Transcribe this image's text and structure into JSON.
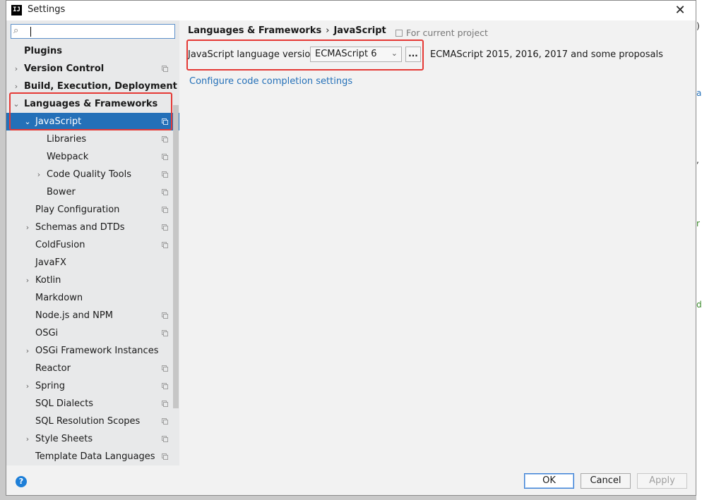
{
  "window": {
    "title": "Settings",
    "app_icon_text": "IJ"
  },
  "search": {
    "placeholder": "",
    "value": ""
  },
  "sidebar": {
    "items": [
      {
        "label": "Plugins",
        "bold": true,
        "arrow": "",
        "copy": false
      },
      {
        "label": "Version Control",
        "bold": true,
        "arrow": "right",
        "copy": true
      },
      {
        "label": "Build, Execution, Deployment",
        "bold": true,
        "arrow": "right",
        "copy": false
      },
      {
        "label": "Languages & Frameworks",
        "bold": true,
        "arrow": "down",
        "copy": false
      },
      {
        "label": "JavaScript",
        "bold": false,
        "arrow": "down",
        "copy": true,
        "selected": true
      },
      {
        "label": "Libraries",
        "bold": false,
        "arrow": "",
        "copy": true
      },
      {
        "label": "Webpack",
        "bold": false,
        "arrow": "",
        "copy": true
      },
      {
        "label": "Code Quality Tools",
        "bold": false,
        "arrow": "right",
        "copy": true
      },
      {
        "label": "Bower",
        "bold": false,
        "arrow": "",
        "copy": true
      },
      {
        "label": "Play Configuration",
        "bold": false,
        "arrow": "",
        "copy": true
      },
      {
        "label": "Schemas and DTDs",
        "bold": false,
        "arrow": "right",
        "copy": true
      },
      {
        "label": "ColdFusion",
        "bold": false,
        "arrow": "",
        "copy": true
      },
      {
        "label": "JavaFX",
        "bold": false,
        "arrow": "",
        "copy": false
      },
      {
        "label": "Kotlin",
        "bold": false,
        "arrow": "right",
        "copy": false
      },
      {
        "label": "Markdown",
        "bold": false,
        "arrow": "",
        "copy": false
      },
      {
        "label": "Node.js and NPM",
        "bold": false,
        "arrow": "",
        "copy": true
      },
      {
        "label": "OSGi",
        "bold": false,
        "arrow": "",
        "copy": true
      },
      {
        "label": "OSGi Framework Instances",
        "bold": false,
        "arrow": "right",
        "copy": false
      },
      {
        "label": "Reactor",
        "bold": false,
        "arrow": "",
        "copy": true
      },
      {
        "label": "Spring",
        "bold": false,
        "arrow": "right",
        "copy": true
      },
      {
        "label": "SQL Dialects",
        "bold": false,
        "arrow": "",
        "copy": true
      },
      {
        "label": "SQL Resolution Scopes",
        "bold": false,
        "arrow": "",
        "copy": true
      },
      {
        "label": "Style Sheets",
        "bold": false,
        "arrow": "right",
        "copy": true
      },
      {
        "label": "Template Data Languages",
        "bold": false,
        "arrow": "",
        "copy": true
      }
    ]
  },
  "content": {
    "breadcrumb": {
      "parent": "Languages & Frameworks",
      "separator": "›",
      "current": "JavaScript"
    },
    "scope_label": "For current project",
    "language_version_label": "JavaScript language version",
    "language_version_value": "ECMAScript 6",
    "ellipsis_label": "...",
    "version_description": "ECMAScript 2015, 2016, 2017 and some proposals",
    "completion_link": "Configure code completion settings"
  },
  "buttons": {
    "help": "?",
    "ok": "OK",
    "cancel": "Cancel",
    "apply": "Apply"
  },
  "colors": {
    "selection": "#2470b8",
    "highlight_box": "#e53935",
    "link": "#2470b8"
  }
}
